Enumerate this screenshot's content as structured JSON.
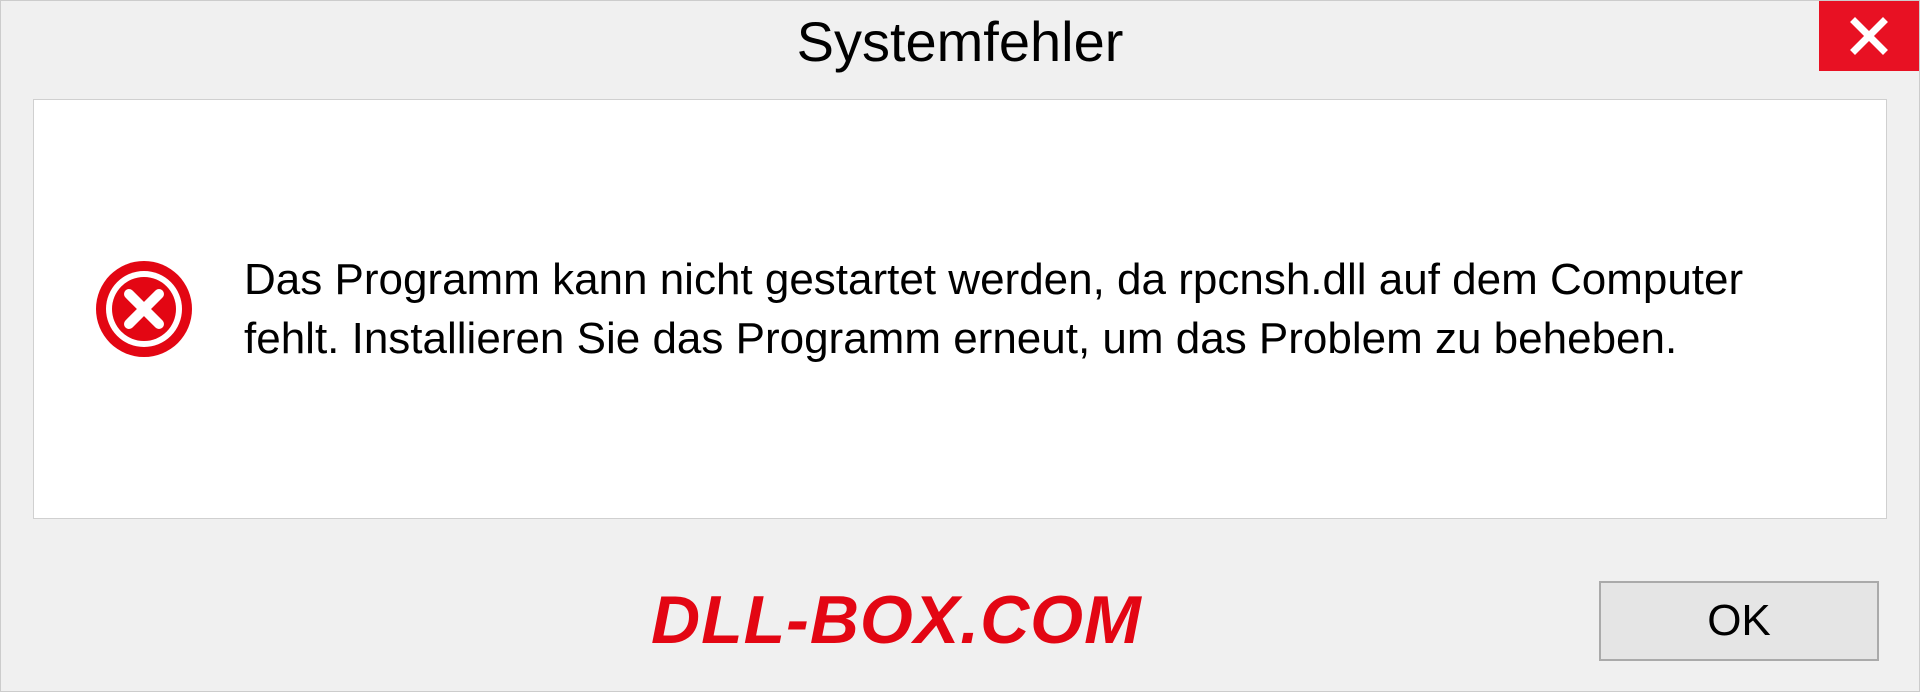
{
  "dialog": {
    "title": "Systemfehler",
    "message": "Das Programm kann nicht gestartet werden, da rpcnsh.dll auf dem Computer fehlt. Installieren Sie das Programm erneut, um das Problem zu beheben.",
    "ok_label": "OK"
  },
  "watermark": "DLL-BOX.COM"
}
